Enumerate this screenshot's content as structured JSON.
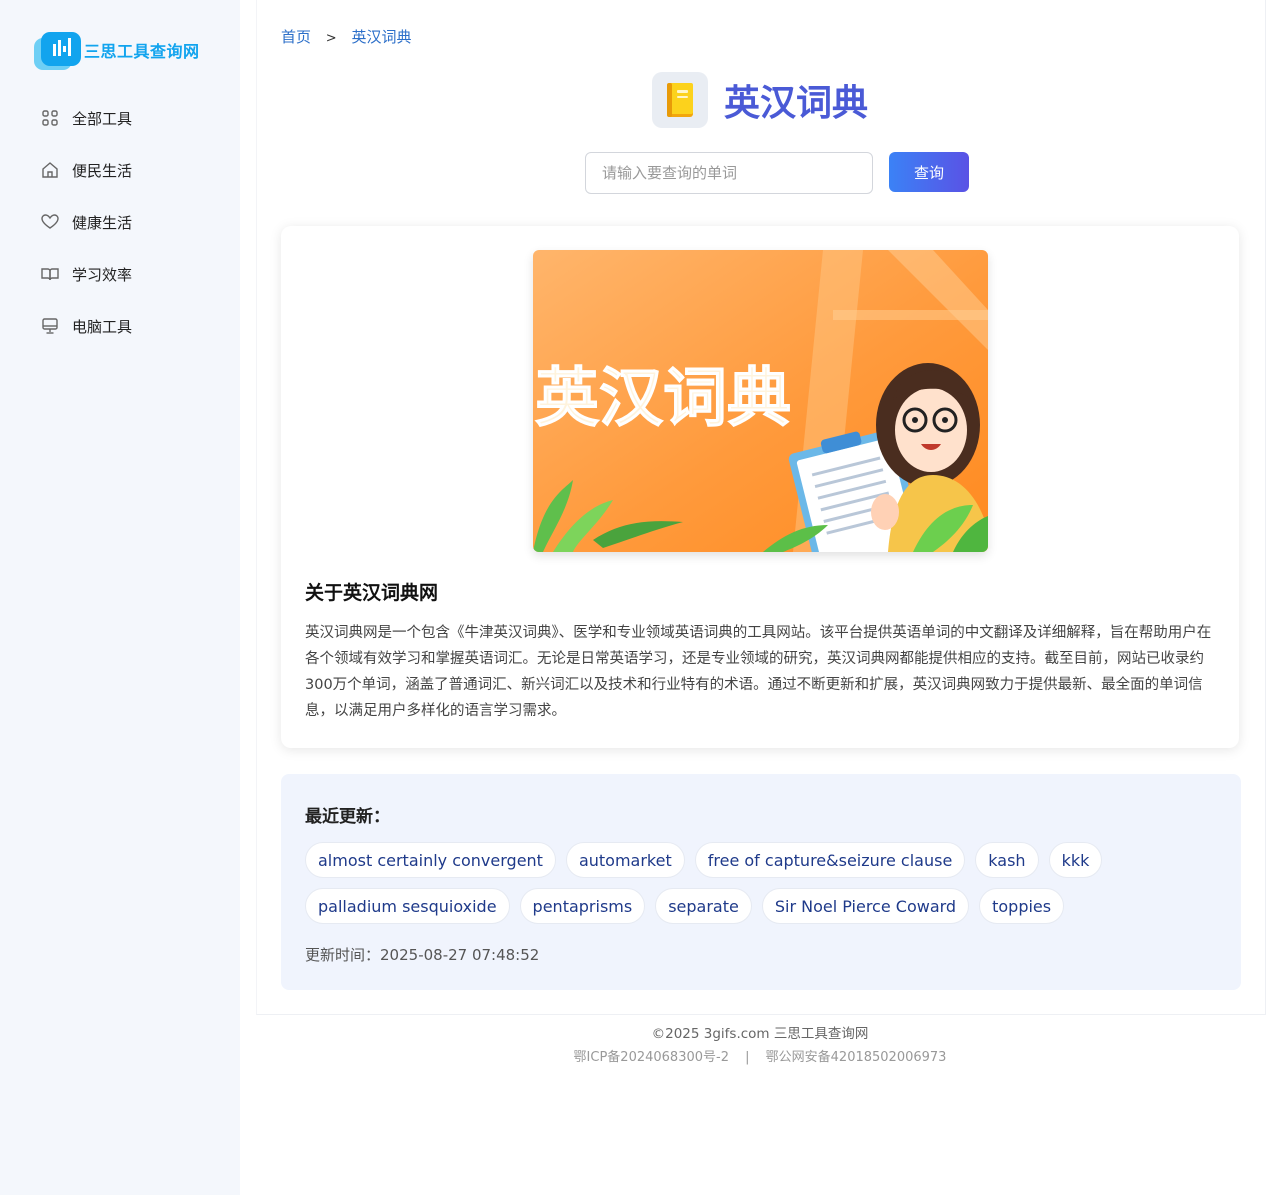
{
  "site": {
    "logo_text": "三思工具查询网"
  },
  "sidebar": {
    "items": [
      {
        "label": "全部工具",
        "icon": "grid-icon"
      },
      {
        "label": "便民生活",
        "icon": "home-icon"
      },
      {
        "label": "健康生活",
        "icon": "heart-icon"
      },
      {
        "label": "学习效率",
        "icon": "book-open-icon"
      },
      {
        "label": "电脑工具",
        "icon": "monitor-icon"
      }
    ]
  },
  "breadcrumb": {
    "home": "首页",
    "separator": ">",
    "current": "英汉词典"
  },
  "header": {
    "title": "英汉词典",
    "icon": "notebook-icon"
  },
  "search": {
    "placeholder": "请输入要查询的单词",
    "value": "",
    "button_label": "查询"
  },
  "about": {
    "banner_text": "英汉词典",
    "title": "关于英汉词典网",
    "description": "英汉词典网是一个包含《牛津英汉词典》、医学和专业领域英语词典的工具网站。该平台提供英语单词的中文翻译及详细解释，旨在帮助用户在各个领域有效学习和掌握英语词汇。无论是日常英语学习，还是专业领域的研究，英汉词典网都能提供相应的支持。截至目前，网站已收录约300万个单词，涵盖了普通词汇、新兴词汇以及技术和行业特有的术语。通过不断更新和扩展，英汉词典网致力于提供最新、最全面的单词信息，以满足用户多样化的语言学习需求。"
  },
  "recent": {
    "title": "最近更新：",
    "rows": [
      [
        "almost certainly convergent",
        "automarket",
        "free of capture&seizure clause",
        "kash",
        "kkk"
      ],
      [
        "palladium sesquioxide",
        "pentaprisms",
        "separate",
        "Sir Noel Pierce Coward",
        "toppies"
      ]
    ],
    "update_label": "更新时间：",
    "update_time": "2025-08-27 07:48:52"
  },
  "footer": {
    "copyright": "©2025 3gifs.com 三思工具查询网",
    "icp": "鄂ICP备2024068300号-2",
    "divider": "|",
    "police": "鄂公网安备42018502006973"
  },
  "colors": {
    "accent": "#12a4ee",
    "title": "#4a5ad6",
    "button_start": "#3b82f6",
    "button_end": "#5a52e5",
    "sidebar_bg": "#f4f7fc",
    "recent_bg": "#f0f4fd",
    "tag_text": "#1f3a8a"
  }
}
